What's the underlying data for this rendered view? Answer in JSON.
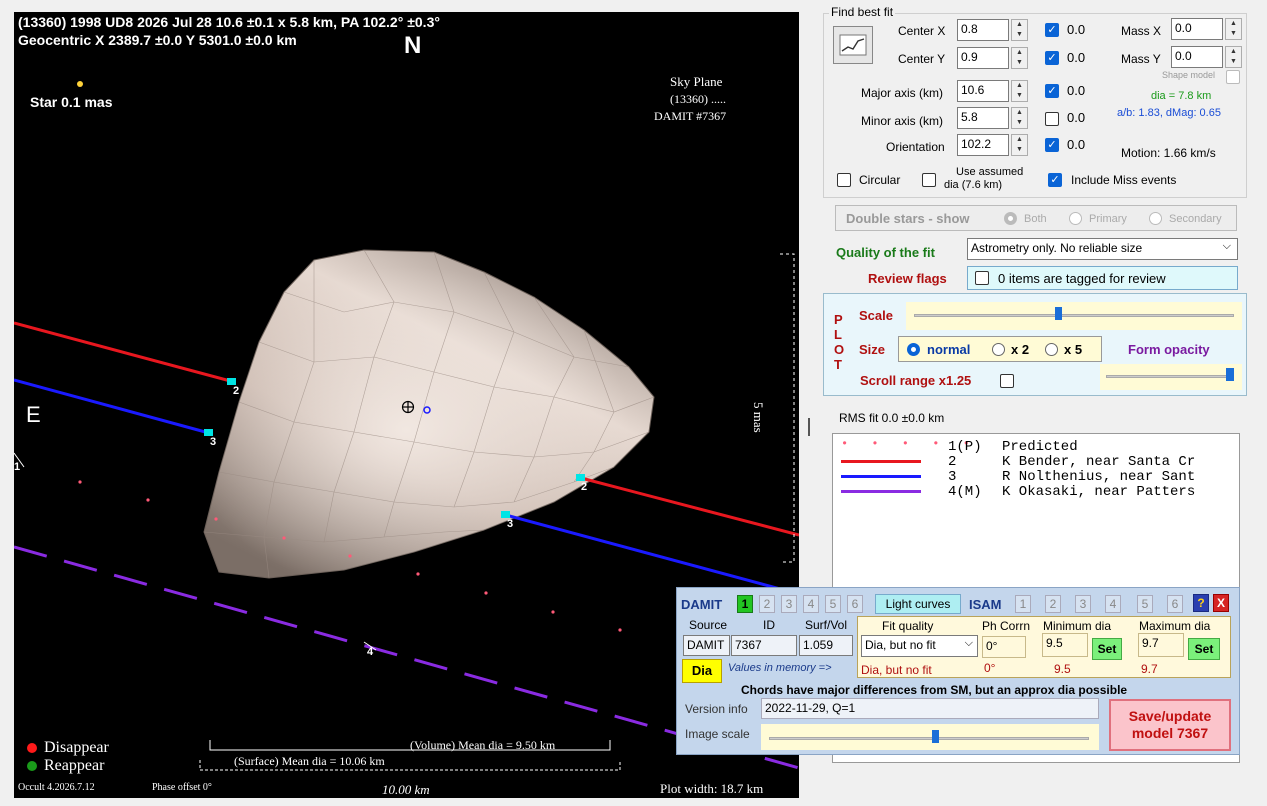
{
  "plot": {
    "header_line1": "(13360) 1998 UD8  2026 Jul 28   10.6 ±0.1 x 5.8 km, PA 102.2° ±0.3°",
    "header_line2": "Geocentric  X  2389.7 ±0.0  Y 5301.0 ±0.0 km",
    "north": "N",
    "east": "E",
    "star_label": "Star 0.1 mas",
    "sky_plane": "Sky Plane",
    "sky_object": "(13360) .....",
    "sky_damit": "DAMIT #7367",
    "scale_vertical": "5 mas",
    "disappear": "Disappear",
    "reappear": "Reappear",
    "volume_dia": "(Volume) Mean dia = 9.50 km",
    "surface_dia": "(Surface) Mean dia = 10.06 km",
    "scale_bar": "10.00 km",
    "version": "Occult 4.2026.7.12",
    "phase_offset": "Phase offset 0°",
    "plot_width": "Plot width: 18.7 km",
    "chord_labels": [
      "1",
      "2",
      "2",
      "3",
      "3",
      "4"
    ],
    "colors": {
      "red": "#e8171f",
      "blue": "#1a1aff",
      "purple": "#8a2be2",
      "disappear": "#ff1a1a",
      "reappear": "#1a9a1a"
    }
  },
  "fit": {
    "title": "Find best fit",
    "center_x_label": "Center X",
    "center_x": "0.8",
    "center_x_chk": "0.0",
    "center_y_label": "Center Y",
    "center_y": "0.9",
    "center_y_chk": "0.0",
    "major_label": "Major axis (km)",
    "major": "10.6",
    "major_chk": "0.0",
    "minor_label": "Minor axis (km)",
    "minor": "5.8",
    "minor_chk": "0.0",
    "orient_label": "Orientation",
    "orient": "102.2",
    "orient_chk": "0.0",
    "mass_x_label": "Mass X",
    "mass_x": "0.0",
    "mass_y_label": "Mass Y",
    "mass_y": "0.0",
    "shape_model": "Shape model",
    "dia": "dia = 7.8 km",
    "ab": "a/b: 1.83, dMag: 0.65",
    "motion": "Motion: 1.66 km/s",
    "circular": "Circular",
    "use_assumed_1": "Use assumed",
    "use_assumed_2": "dia (7.6 km)",
    "include_miss": "Include Miss events",
    "double_stars": "Double stars - show",
    "both": "Both",
    "primary": "Primary",
    "secondary": "Secondary",
    "quality_label": "Quality of the fit",
    "quality_value": "Astrometry only. No reliable size",
    "review_label": "Review flags",
    "review_value": "0 items are tagged for review"
  },
  "plotctl": {
    "plot_letters": [
      "P",
      "L",
      "O",
      "T"
    ],
    "scale": "Scale",
    "scale_level": 0.45,
    "size": "Size",
    "normal": "normal",
    "x2": "x 2",
    "x5": "x 5",
    "form_opacity": "Form opacity",
    "opacity_level": 1.0,
    "scroll_range": "Scroll range x1.25"
  },
  "rms": "RMS fit 0.0 ±0.0 km",
  "legend": [
    {
      "num": "1(P)",
      "text": "Predicted"
    },
    {
      "num": "2   ",
      "text": "K Bender, near Santa Cr"
    },
    {
      "num": "3   ",
      "text": "R Nolthenius, near Sant"
    },
    {
      "num": "4(M)",
      "text": "K Okasaki, near Patters"
    }
  ],
  "damit": {
    "title": "DAMIT",
    "tabs": [
      "1",
      "2",
      "3",
      "4",
      "5",
      "6"
    ],
    "light_curves": "Light curves",
    "isam": "ISAM",
    "isam_tabs": [
      "1",
      "2",
      "3",
      "4",
      "5",
      "6"
    ],
    "help": "?",
    "close": "X",
    "h_source": "Source",
    "h_id": "ID",
    "h_surf": "Surf/Vol",
    "h_fit": "Fit quality",
    "h_ph": "Ph Corrn",
    "h_min": "Minimum dia",
    "h_max": "Maximum dia",
    "source": "DAMIT",
    "id": "7367",
    "surf": "1.059",
    "fit_value": "Dia, but no fit",
    "ph": "0°",
    "min": "9.5",
    "max": "9.7",
    "set": "Set",
    "dia_btn": "Dia",
    "mem_label": "Values in memory =>",
    "mem_fit": "Dia, but no fit",
    "mem_ph": "0°",
    "mem_min": "9.5",
    "mem_max": "9.7",
    "warning": "Chords have major differences from SM, but an approx dia possible",
    "version_label": "Version info",
    "version": "2022-11-29, Q=1",
    "image_scale": "Image scale",
    "image_scale_level": 0.52,
    "save_1": "Save/update",
    "save_2": "model 7367"
  }
}
